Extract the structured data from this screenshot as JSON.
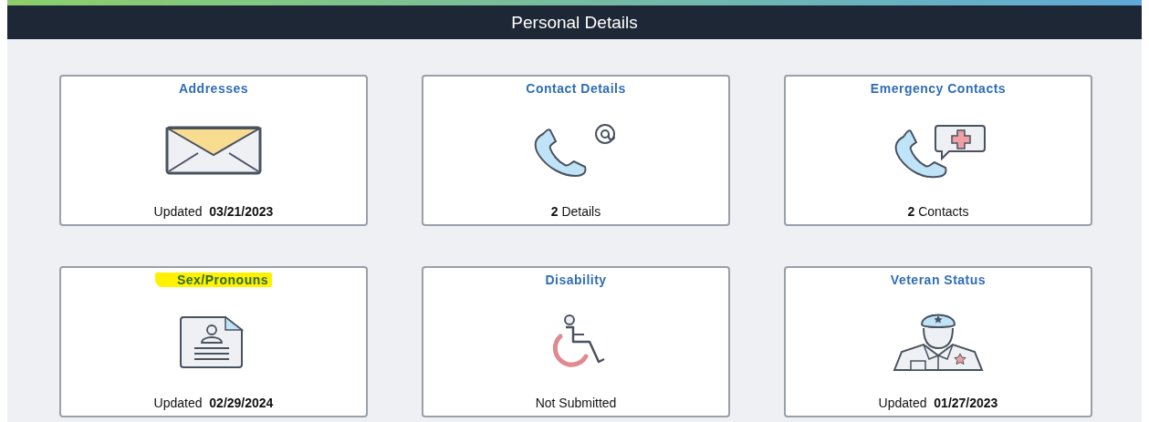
{
  "header": {
    "title": "Personal Details"
  },
  "tiles": [
    {
      "title": "Addresses",
      "highlighted": false,
      "footer": "Updated  **03/21/2023**"
    },
    {
      "title": "Contact Details",
      "highlighted": false,
      "footer": "**2** Details"
    },
    {
      "title": "Emergency Contacts",
      "highlighted": false,
      "footer": "**2** Contacts"
    },
    {
      "title": "Sex/Pronouns",
      "highlighted": true,
      "footer": "Updated  **02/29/2024**"
    },
    {
      "title": "Disability",
      "highlighted": false,
      "footer": "Not Submitted"
    },
    {
      "title": "Veteran Status",
      "highlighted": false,
      "footer": "Updated  **01/27/2023**"
    }
  ]
}
